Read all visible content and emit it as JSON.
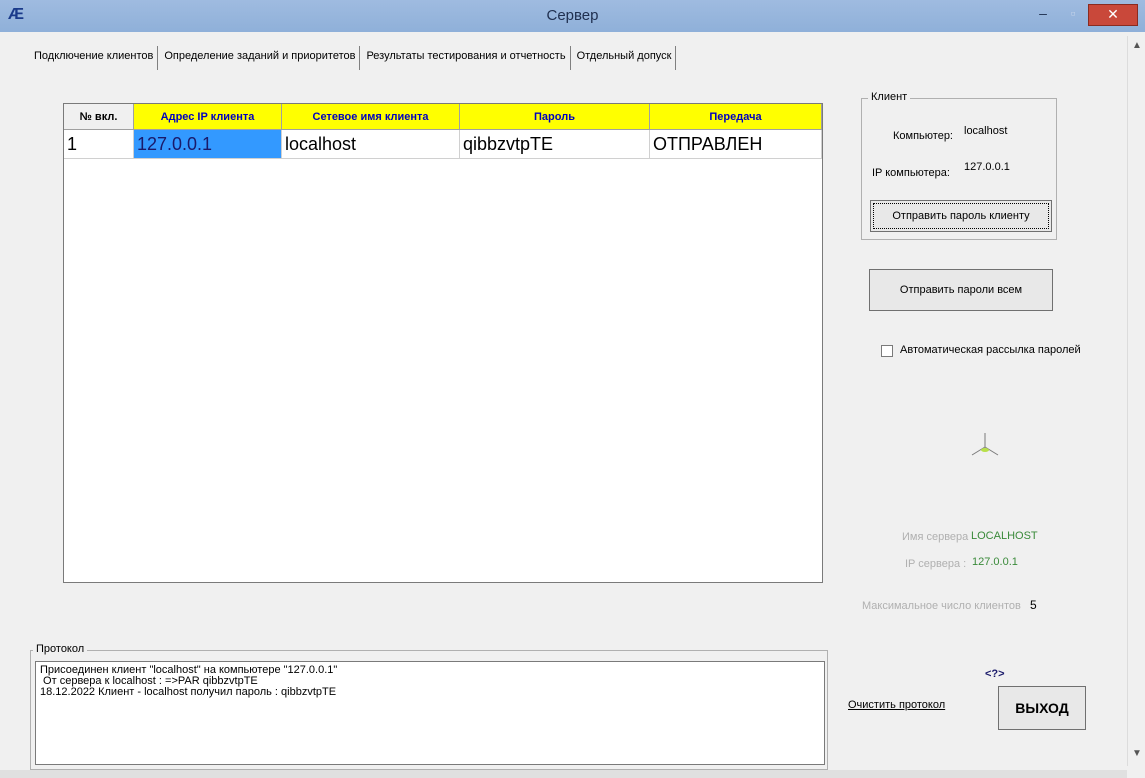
{
  "window": {
    "title": "Сервер",
    "app_icon": "app-logo-icon"
  },
  "tabs": [
    {
      "label": "Подключение клиентов",
      "active": true
    },
    {
      "label": "Определение заданий и приоритетов",
      "active": false
    },
    {
      "label": "Результаты тестирования и отчетность",
      "active": false
    },
    {
      "label": "Отдельный допуск",
      "active": false
    }
  ],
  "grid": {
    "columns": [
      "№ вкл.",
      "Адрес IP клиента",
      "Сетевое имя клиента",
      "Пароль",
      "Передача"
    ],
    "header_colors": {
      "fixed": "#f0f0f0",
      "highlight": "#ffff00",
      "highlight_text": "#0000c0"
    },
    "rows": [
      [
        "1",
        "127.0.0.1",
        "localhost",
        "qibbzvtpTE",
        "ОТПРАВЛЕН"
      ]
    ]
  },
  "client_group": {
    "title": "Клиент",
    "computer_label": "Компьютер:",
    "computer_value": "localhost",
    "ip_label": "IP компьютера:",
    "ip_value": "127.0.0.1",
    "send_button": "Отправить пароль клиенту"
  },
  "send_all_button": "Отправить пароли всем",
  "auto_send": {
    "label": "Автоматическая рассылка паролей",
    "checked": false
  },
  "server_info": {
    "name_label": "Имя сервера",
    "name_value": "LOCALHOST",
    "ip_label": "IP сервера :",
    "ip_value": "127.0.0.1",
    "max_clients_label": "Максимальное число клиентов",
    "max_clients_value": "5"
  },
  "protocol": {
    "title": "Протокол",
    "lines": [
      "Присоединен клиент \"localhost\" на компьютере \"127.0.0.1\"",
      " От сервера к localhost : =>PAR qibbzvtpTE",
      "18.12.2022 Клиент - localhost получил пароль : qibbzvtpTE"
    ]
  },
  "help_label": "<?>",
  "clear_button": "Очистить протокол",
  "exit_button": "ВЫХОД"
}
